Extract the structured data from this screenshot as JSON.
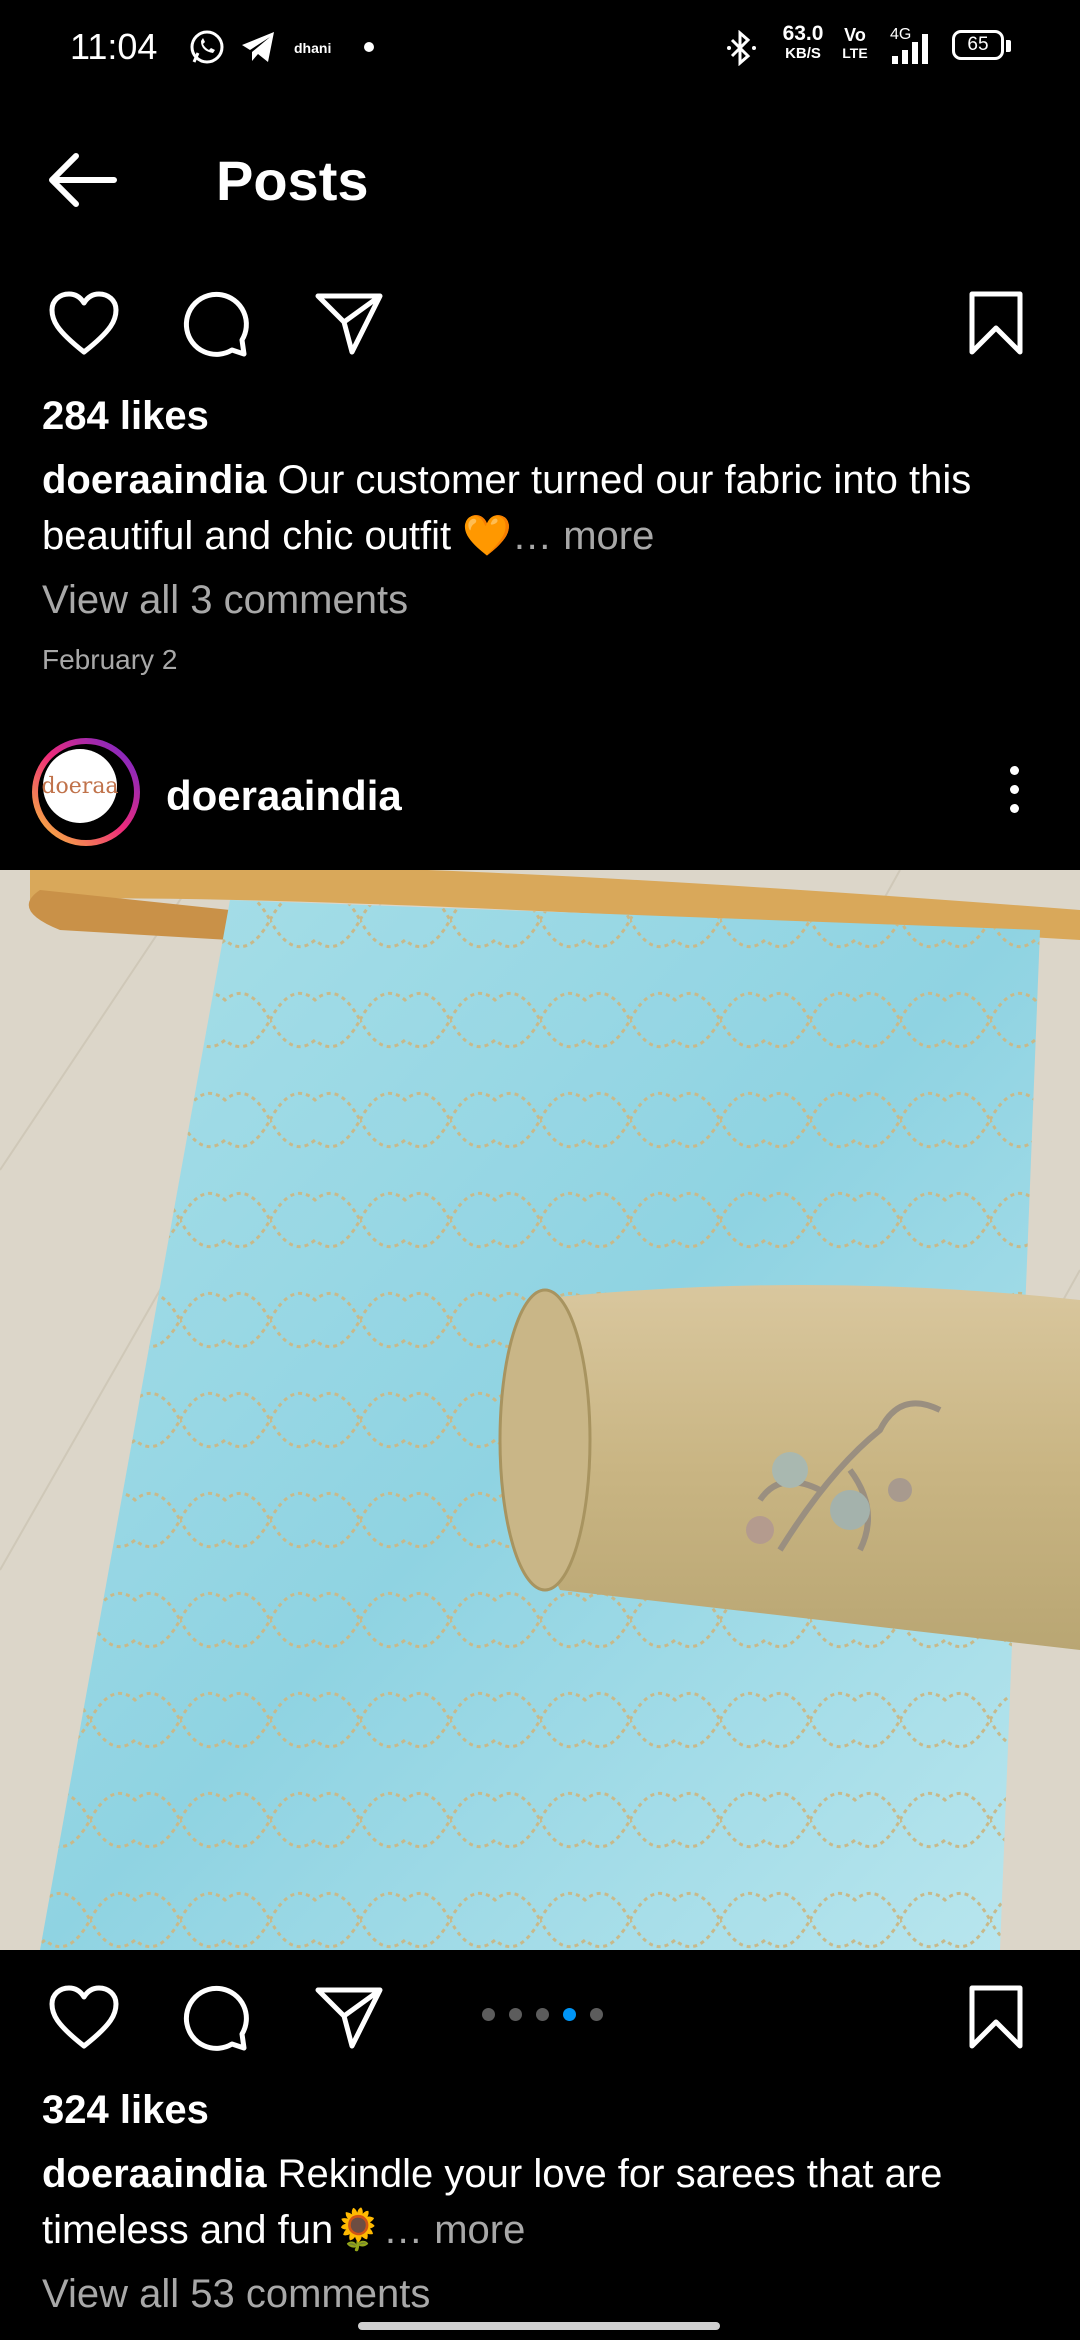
{
  "status_bar": {
    "time": "11:04",
    "app_label": "dhani",
    "net_speed": "63.0",
    "net_unit": "KB/S",
    "volte": "Vo",
    "lte": "LTE",
    "network": "4G",
    "battery": "65"
  },
  "header": {
    "title": "Posts"
  },
  "post1": {
    "likes": "284 likes",
    "username": "doeraaindia",
    "caption": " Our customer turned our fabric into this beautiful and chic outfit 🧡",
    "more": "… more",
    "comments": "View all 3 comments",
    "date": "February 2"
  },
  "post2": {
    "username": "doeraaindia",
    "avatar_text": "doeraa",
    "likes": "324 likes",
    "caption": " Rekindle your love for sarees that are timeless and fun🌻",
    "more": "… more",
    "comments": "View all 53 comments",
    "carousel_total": 5,
    "carousel_active": 4,
    "image_alt": "Light blue embroidered sequin fabric with golden organza roll"
  },
  "colors": {
    "accent": "#0095f6",
    "muted": "#a8a8a8",
    "background": "#000000"
  }
}
